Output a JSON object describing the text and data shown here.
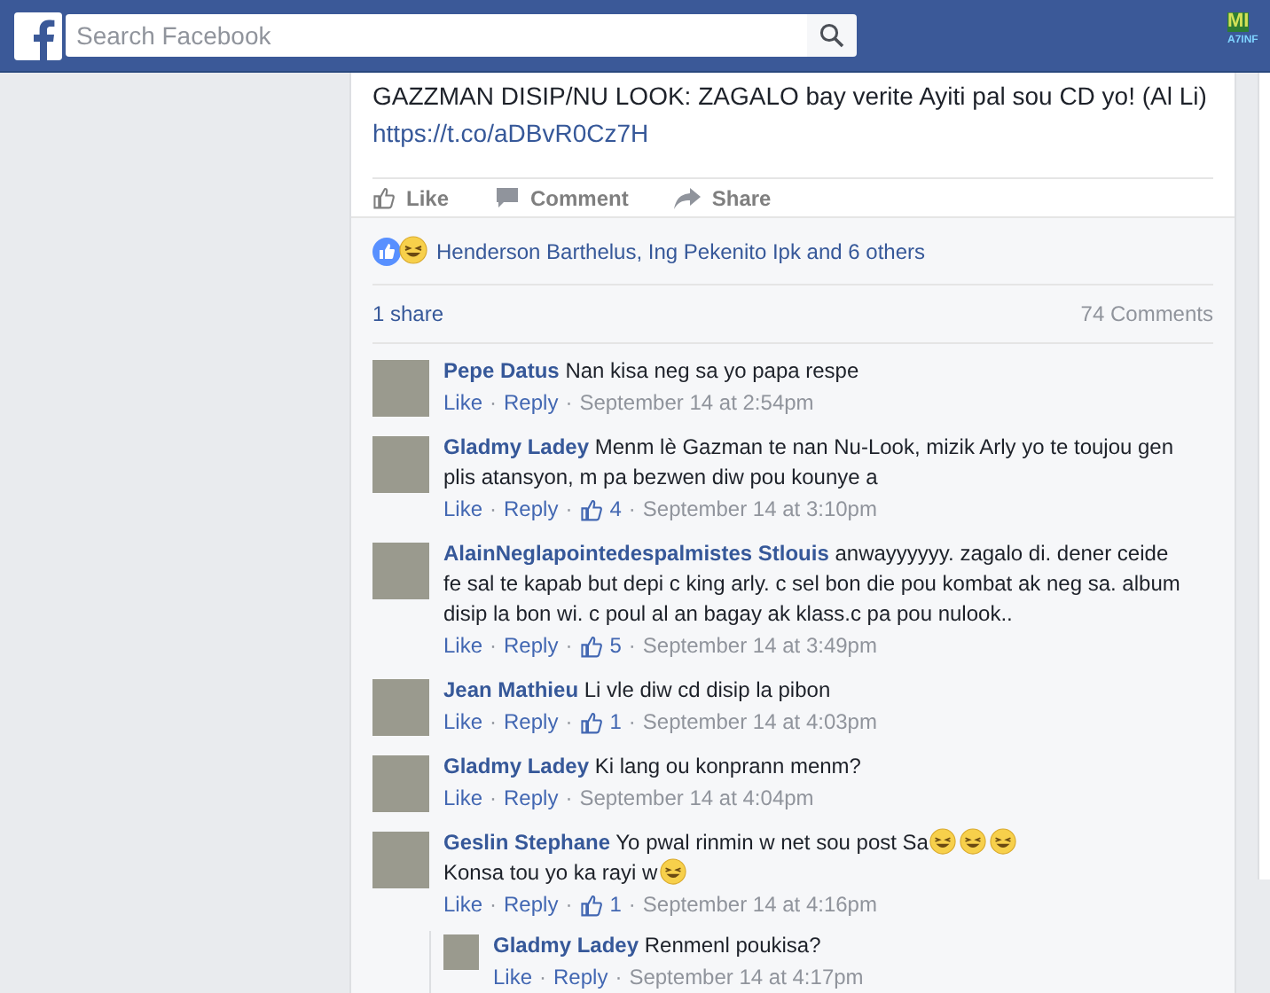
{
  "header": {
    "search": {
      "placeholder": "Search Facebook"
    },
    "corner_logo": {
      "line_1": "MI",
      "line_2": "A7INF"
    }
  },
  "post": {
    "text": "GAZZMAN DISIP/NU LOOK: ZAGALO bay verite Ayiti pal sou CD yo! (Al Li)",
    "link": "https://t.co/aDBvR0Cz7H",
    "actions": [
      {
        "kind": "like",
        "label": "Like"
      },
      {
        "kind": "comment",
        "label": "Comment"
      },
      {
        "kind": "share",
        "label": "Share"
      }
    ],
    "reactions": "Henderson Barthelus, Ing Pekenito Ipk and 6 others",
    "shares": "1 share",
    "comment_count": "74 Comments"
  },
  "separator": "·",
  "comments": [
    {
      "name": "Pepe Datus",
      "body": [
        {
          "kind": "text",
          "text": "Nan kisa neg sa yo papa respe"
        }
      ],
      "like": "Like",
      "reply": "Reply",
      "time": "September 14 at 2:54pm"
    },
    {
      "name": "Gladmy Ladey",
      "body": [
        {
          "kind": "text",
          "text": "Menm lè Gazman te nan Nu-Look, mizik Arly yo te toujou gen plis atansyon, m pa bezwen diw pou kounye a"
        }
      ],
      "like": "Like",
      "reply": "Reply",
      "likes": "4",
      "time": "September 14 at 3:10pm"
    },
    {
      "name": "AlainNeglapointedespalmistes Stlouis",
      "body": [
        {
          "kind": "text",
          "text": "anwayyyyyy. zagalo di. dener ceide fe sal te kapab but depi c king arly. c sel bon die pou kombat ak neg sa. album disip la bon wi. c poul al an bagay ak klass.c pa pou nulook.."
        }
      ],
      "like": "Like",
      "reply": "Reply",
      "likes": "5",
      "time": "September 14 at 3:49pm"
    },
    {
      "name": "Jean Mathieu",
      "body": [
        {
          "kind": "text",
          "text": "Li vle diw cd disip la pibon"
        }
      ],
      "like": "Like",
      "reply": "Reply",
      "likes": "1",
      "time": "September 14 at 4:03pm"
    },
    {
      "name": "Gladmy Ladey",
      "body": [
        {
          "kind": "text",
          "text": "Ki lang ou konprann menm?"
        }
      ],
      "like": "Like",
      "reply": "Reply",
      "time": "September 14 at 4:04pm"
    },
    {
      "name": "Geslin Stephane",
      "body": [
        {
          "kind": "text",
          "text": "Yo pwal rinmin w net sou post Sa"
        },
        {
          "kind": "emoji"
        },
        {
          "kind": "emoji"
        },
        {
          "kind": "emoji"
        },
        {
          "kind": "break"
        },
        {
          "kind": "text",
          "text": "Konsa tou yo ka rayi w"
        },
        {
          "kind": "emoji"
        }
      ],
      "like": "Like",
      "reply": "Reply",
      "likes": "1",
      "time": "September 14 at 4:16pm",
      "replies": [
        {
          "name": "Gladmy Ladey",
          "body": [
            {
              "kind": "text",
              "text": "Renmenl poukisa?"
            }
          ],
          "like": "Like",
          "reply": "Reply",
          "time": "September 14 at 4:17pm"
        }
      ]
    }
  ]
}
